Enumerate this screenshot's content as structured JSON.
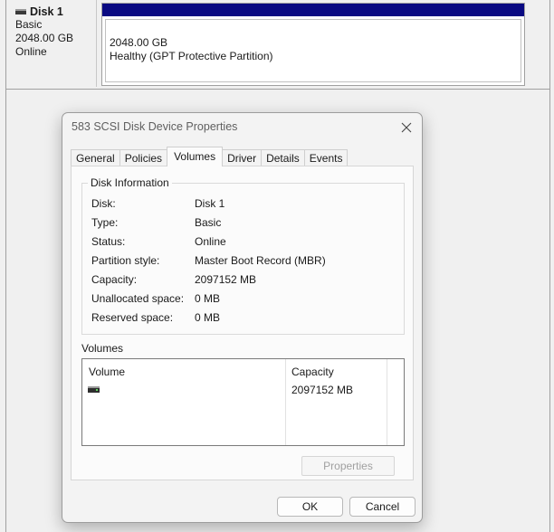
{
  "disk_panel": {
    "name": "Disk 1",
    "type": "Basic",
    "size": "2048.00 GB",
    "status": "Online",
    "partition": {
      "size": "2048.00 GB",
      "status": "Healthy (GPT Protective Partition)",
      "bar_color": "#0a0a82"
    }
  },
  "dialog": {
    "title": "583  SCSI Disk Device Properties",
    "close_icon": "close-icon",
    "tabs": [
      {
        "label": "General"
      },
      {
        "label": "Policies"
      },
      {
        "label": "Volumes"
      },
      {
        "label": "Driver"
      },
      {
        "label": "Details"
      },
      {
        "label": "Events"
      }
    ],
    "active_tab": "Volumes",
    "disk_info": {
      "title": "Disk Information",
      "rows": [
        {
          "label": "Disk:",
          "value": "Disk 1"
        },
        {
          "label": "Type:",
          "value": "Basic"
        },
        {
          "label": "Status:",
          "value": "Online"
        },
        {
          "label": "Partition style:",
          "value": "Master Boot Record (MBR)"
        },
        {
          "label": "Capacity:",
          "value": "2097152 MB"
        },
        {
          "label": "Unallocated space:",
          "value": "0 MB"
        },
        {
          "label": "Reserved space:",
          "value": "0 MB"
        }
      ]
    },
    "volumes": {
      "title": "Volumes",
      "columns": [
        "Volume",
        "Capacity"
      ],
      "rows": [
        {
          "volume": "",
          "icon": "drive-icon",
          "capacity": "2097152 MB"
        }
      ]
    },
    "properties_button": "Properties",
    "ok_button": "OK",
    "cancel_button": "Cancel"
  }
}
